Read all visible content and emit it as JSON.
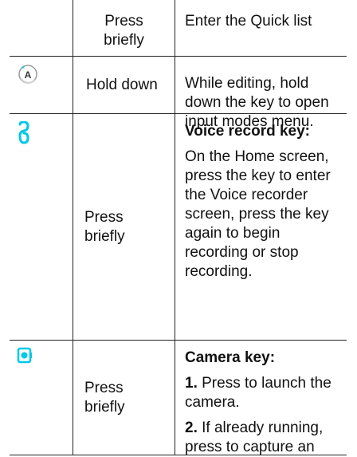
{
  "rows": [
    {
      "action": "Press\nbriefly",
      "description": "Enter the Quick list"
    },
    {
      "icon": "input-mode-key-icon",
      "action": "Hold down",
      "description": "While editing, hold down the key to open input modes menu."
    },
    {
      "icon": "voice-record-key-icon",
      "action": "Press briefly",
      "title": "Voice record key:",
      "description": "On the Home screen, press the key to enter the Voice recorder screen, press the key again to begin recording or stop recording."
    },
    {
      "icon": "camera-key-icon",
      "action": "Press briefly",
      "title": "Camera key:",
      "item1_num": "1.",
      "item1_text": " Press to launch the camera.",
      "item2_num": "2.",
      "item2_text": " If already running, press to capture an"
    }
  ],
  "colors": {
    "icon_cyan": "#00c8e8",
    "rule": "#222222"
  }
}
